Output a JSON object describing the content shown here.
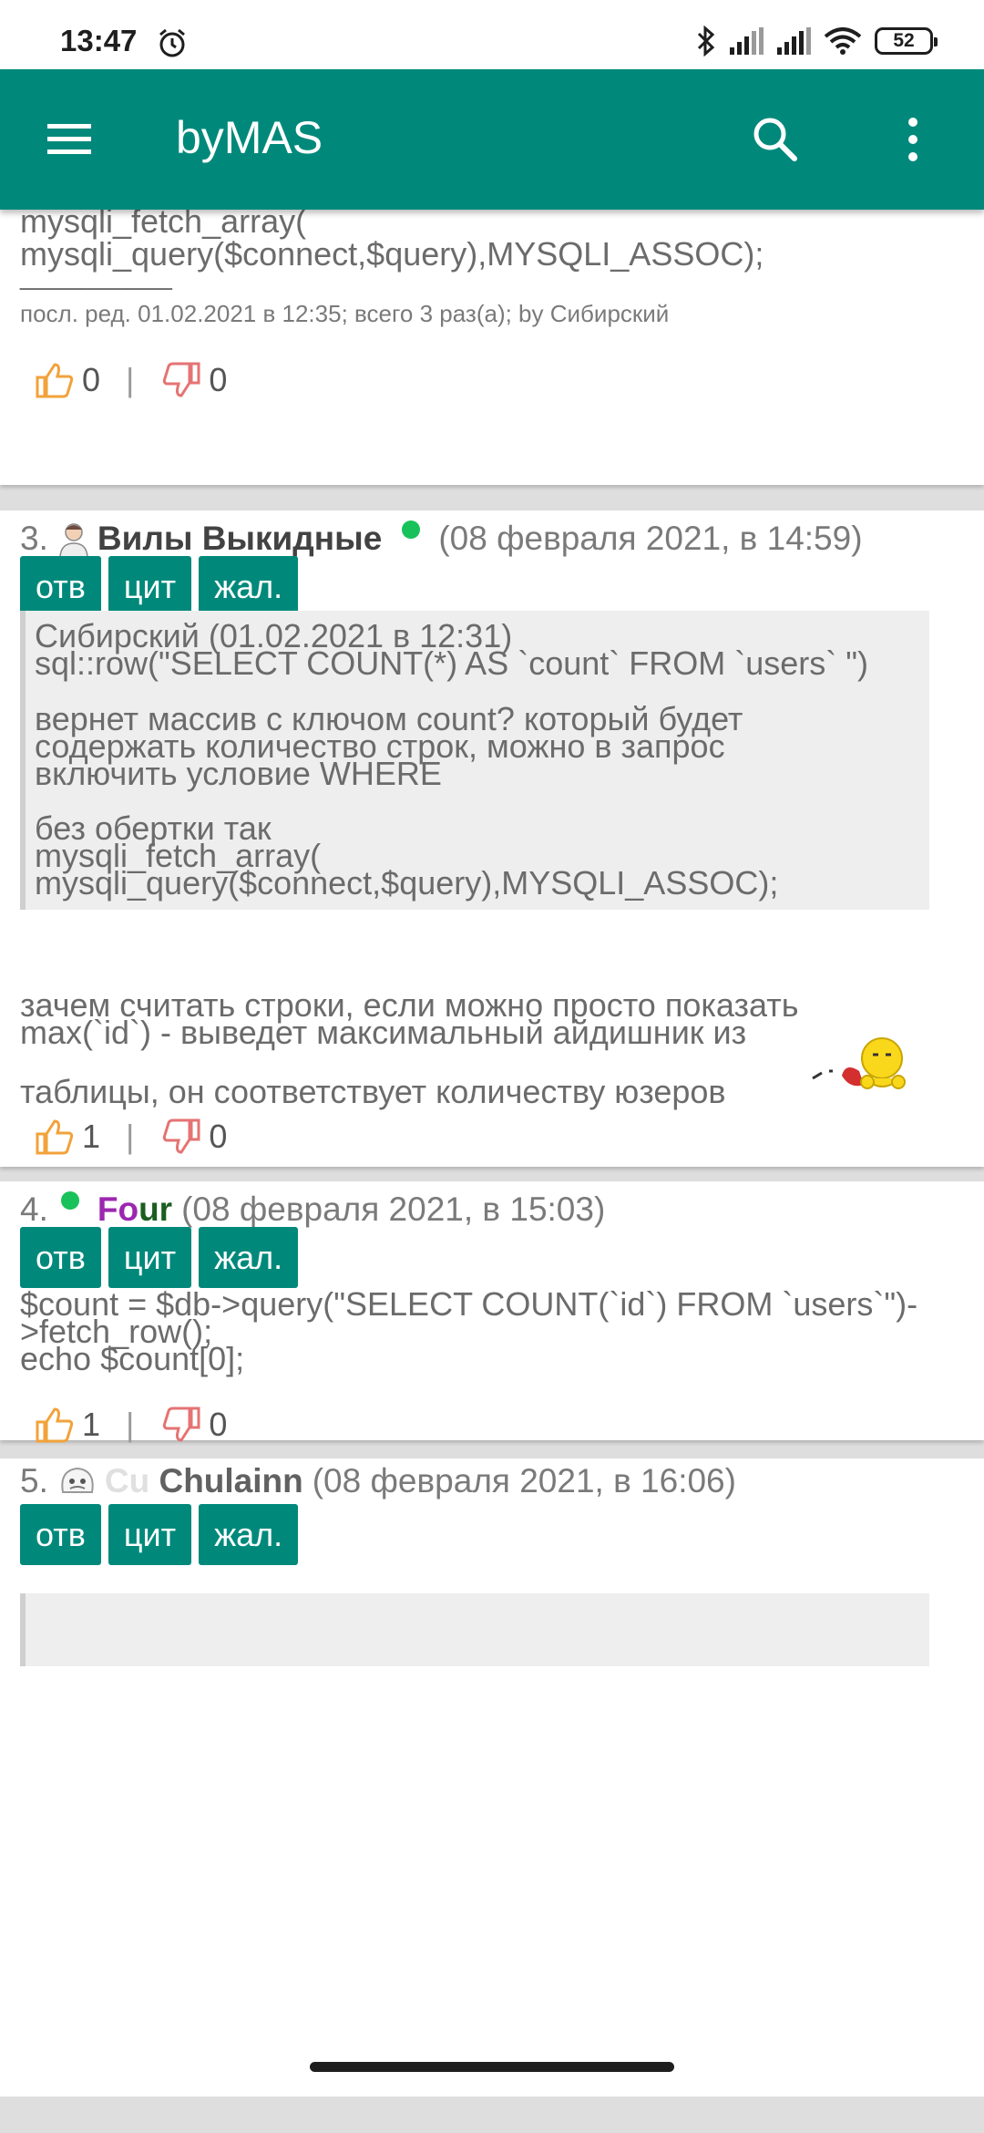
{
  "status_bar": {
    "time": "13:47",
    "battery": "52"
  },
  "app": {
    "title": "byMAS"
  },
  "buttons": {
    "reply": "отв",
    "quote": "цит",
    "complain": "жал."
  },
  "vote_separator": "|",
  "post2": {
    "lines": [
      "mysqli_fetch_array(",
      "mysqli_query($connect,$query),MYSQLI_ASSOC);",
      "__________"
    ],
    "edit_note": "посл. ред. 01.02.2021 в 12:35; всего 3 раз(а); by Сибирский",
    "likes": "0",
    "dislikes": "0"
  },
  "post3": {
    "number": "3.",
    "author": "Вилы Выкидные",
    "date": "(08 февраля 2021, в 14:59)",
    "quote_lines": [
      "Сибирский (01.02.2021 в 12:31)",
      "sql::row(\"SELECT COUNT(*) AS `count` FROM `users` \")",
      "",
      "вернет массив с ключом count? который будет",
      "содержать количество строк, можно в запрос",
      "включить условие WHERE",
      "",
      "без обертки так",
      "mysqli_fetch_array(",
      "mysqli_query($connect,$query),MYSQLI_ASSOC);"
    ],
    "body_lines": [
      "зачем считать строки, если можно просто показать",
      "max(`id`) - выведет максимальный айдишник из",
      "таблицы, он соответствует количеству юзеров"
    ],
    "likes": "1",
    "dislikes": "0"
  },
  "post4": {
    "number": "4.",
    "author_part1": "Fo",
    "author_part2": "ur",
    "date": "(08 февраля 2021, в 15:03)",
    "body_lines": [
      "$count = $db->query(\"SELECT COUNT(`id`) FROM `users`\")-",
      ">fetch_row();",
      "echo $count[0];"
    ],
    "likes": "1",
    "dislikes": "0"
  },
  "post5": {
    "number": "5.",
    "author_part1": "Cu",
    "author_part2": " Chulainn",
    "date": "(08 февраля 2021, в 16:06)"
  }
}
